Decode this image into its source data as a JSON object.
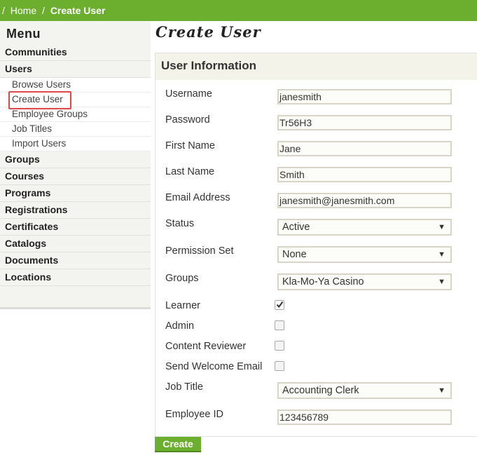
{
  "breadcrumb": {
    "separator": "/",
    "home": "Home",
    "current": "Create User"
  },
  "sidebar": {
    "title": "Menu",
    "items": [
      {
        "label": "Communities"
      },
      {
        "label": "Users",
        "subitems": [
          "Browse Users",
          "Create User",
          "Employee Groups",
          "Job Titles",
          "Import Users"
        ]
      },
      {
        "label": "Groups"
      },
      {
        "label": "Courses"
      },
      {
        "label": "Programs"
      },
      {
        "label": "Registrations"
      },
      {
        "label": "Certificates"
      },
      {
        "label": "Catalogs"
      },
      {
        "label": "Documents"
      },
      {
        "label": "Locations"
      }
    ]
  },
  "main": {
    "page_title": "Create User",
    "panel_title": "User Information",
    "fields": {
      "username": {
        "label": "Username",
        "value": "janesmith"
      },
      "password": {
        "label": "Password",
        "value": "Tr56H3"
      },
      "first_name": {
        "label": "First Name",
        "value": "Jane"
      },
      "last_name": {
        "label": "Last Name",
        "value": "Smith"
      },
      "email": {
        "label": "Email Address",
        "value": "janesmith@janesmith.com"
      },
      "status": {
        "label": "Status",
        "value": "Active"
      },
      "permission_set": {
        "label": "Permission Set",
        "value": "None"
      },
      "groups": {
        "label": "Groups",
        "value": "Kla-Mo-Ya Casino"
      },
      "learner": {
        "label": "Learner",
        "checked": true
      },
      "admin": {
        "label": "Admin",
        "checked": false
      },
      "content_reviewer": {
        "label": "Content Reviewer",
        "checked": false
      },
      "send_welcome_email": {
        "label": "Send Welcome Email",
        "checked": false
      },
      "job_title": {
        "label": "Job Title",
        "value": "Accounting Clerk"
      },
      "employee_id": {
        "label": "Employee ID",
        "value": "123456789"
      }
    },
    "create_button": "Create"
  },
  "colors": {
    "brand_green": "#6cae2e",
    "highlight_red": "#e0474c"
  }
}
